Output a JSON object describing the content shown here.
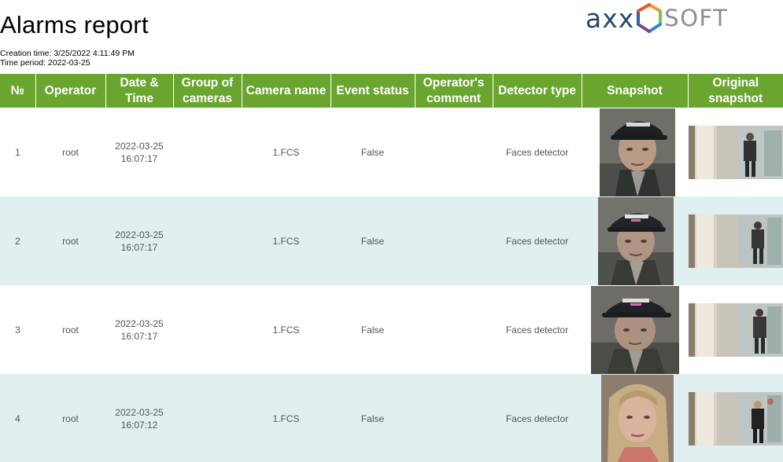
{
  "report": {
    "title": "Alarms report",
    "creation_time": "Creation time: 3/25/2022 4:11:49 PM",
    "time_period": "Time period: 2022-03-25"
  },
  "logo": {
    "left_text": "axx",
    "right_text": "SOFT",
    "colors": {
      "dark": "#254a69",
      "gray": "#8a8f94",
      "hex_orange": "#f39a21",
      "hex_green": "#7cc243",
      "hex_blue": "#2e86c8",
      "hex_purple": "#7a3f98"
    }
  },
  "theme": {
    "header_green": "#6aa62f",
    "row_alt": "#e0f0f0"
  },
  "table": {
    "columns": [
      "№",
      "Operator",
      "Date & Time",
      "Group of cameras",
      "Camera name",
      "Event status",
      "Operator's comment",
      "Detector type",
      "Snapshot",
      "Original snapshot"
    ],
    "rows": [
      {
        "no": "1",
        "operator": "root",
        "date": "2022-03-25",
        "time": "16:07:17",
        "group": "",
        "camera": "1.FCS",
        "status": "False",
        "comment": "",
        "detector": "Faces detector"
      },
      {
        "no": "2",
        "operator": "root",
        "date": "2022-03-25",
        "time": "16:07:17",
        "group": "",
        "camera": "1.FCS",
        "status": "False",
        "comment": "",
        "detector": "Faces detector"
      },
      {
        "no": "3",
        "operator": "root",
        "date": "2022-03-25",
        "time": "16:07:17",
        "group": "",
        "camera": "1.FCS",
        "status": "False",
        "comment": "",
        "detector": "Faces detector"
      },
      {
        "no": "4",
        "operator": "root",
        "date": "2022-03-25",
        "time": "16:07:12",
        "group": "",
        "camera": "1.FCS",
        "status": "False",
        "comment": "",
        "detector": "Faces detector"
      }
    ]
  }
}
